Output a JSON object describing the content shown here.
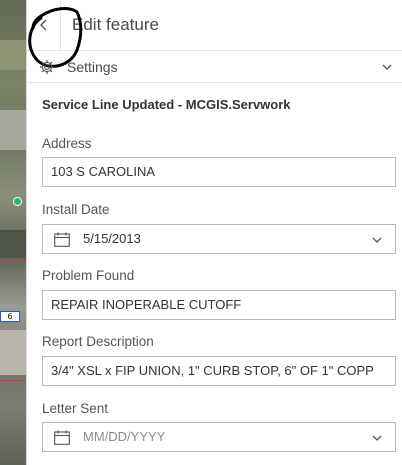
{
  "header": {
    "title": "Edit feature",
    "back_icon": "chevron-left-icon"
  },
  "settings": {
    "label": "Settings",
    "icon": "gear-icon",
    "chevron": "chevron-down-icon"
  },
  "layer_title": "Service Line Updated - MCGIS.Servwork",
  "fields": {
    "address": {
      "label": "Address",
      "value": "103 S CAROLINA"
    },
    "install_date": {
      "label": "Install Date",
      "value": "5/15/2013"
    },
    "problem_found": {
      "label": "Problem Found",
      "value": "REPAIR INOPERABLE CUTOFF"
    },
    "report_description": {
      "label": "Report Description",
      "value": "3/4\" XSL x FIP UNION, 1\" CURB STOP, 6\" OF 1\" COPP"
    },
    "letter_sent": {
      "label": "Letter Sent",
      "placeholder": "MM/DD/YYYY"
    }
  },
  "map": {
    "tag_label": "6"
  },
  "colors": {
    "accent_red": "#d23a2e",
    "marker_green": "#2fae78",
    "tag_blue": "#1f5fbf"
  }
}
